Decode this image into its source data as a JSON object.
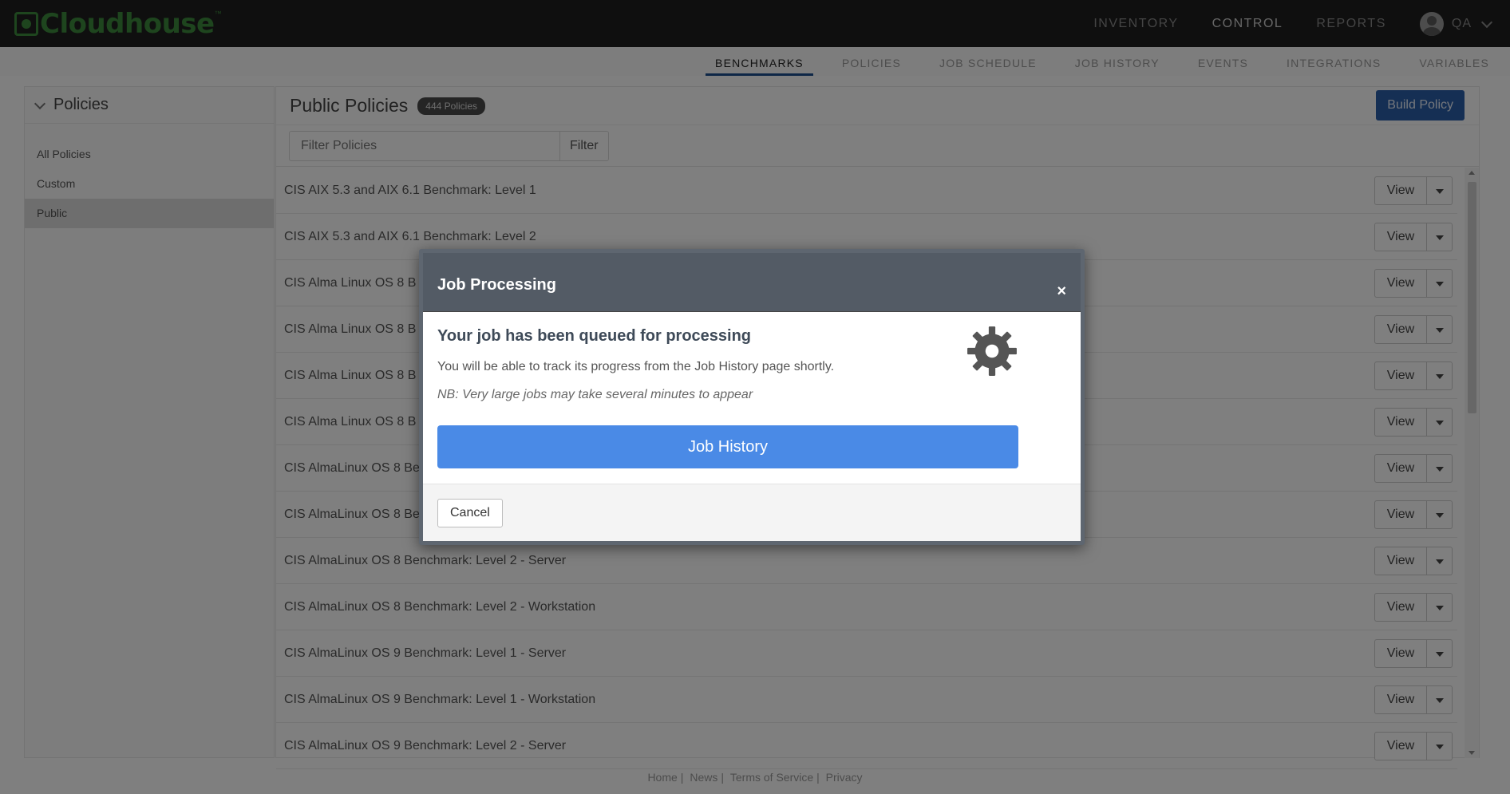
{
  "app": {
    "logo_text": "Cloudhouse",
    "logo_tm": "™",
    "colors": {
      "brand": "#3d8a3d",
      "primary_button": "#2a5ea8",
      "modal_button": "#4a8ae6",
      "modal_header": "#535b65"
    }
  },
  "topnav": {
    "items": [
      "INVENTORY",
      "CONTROL",
      "REPORTS"
    ],
    "active": "CONTROL",
    "user_name": "QA"
  },
  "subnav": {
    "items": [
      "BENCHMARKS",
      "POLICIES",
      "JOB SCHEDULE",
      "JOB HISTORY",
      "EVENTS",
      "INTEGRATIONS",
      "VARIABLES"
    ],
    "active": "BENCHMARKS"
  },
  "sidebar": {
    "title": "Policies",
    "items": [
      "All Policies",
      "Custom",
      "Public"
    ],
    "active": "Public"
  },
  "main": {
    "title": "Public Policies",
    "badge": "444 Policies",
    "build_button": "Build Policy",
    "filter_placeholder": "Filter Policies",
    "filter_button": "Filter",
    "view_label": "View",
    "rows": [
      "CIS AIX 5.3 and AIX 6.1 Benchmark: Level 1",
      "CIS AIX 5.3 and AIX 6.1 Benchmark: Level 2",
      "CIS Alma Linux OS 8 B",
      "CIS Alma Linux OS 8 B",
      "CIS Alma Linux OS 8 B",
      "CIS Alma Linux OS 8 B",
      "CIS AlmaLinux OS 8 Be",
      "CIS AlmaLinux OS 8 Be",
      "CIS AlmaLinux OS 8 Benchmark: Level 2 - Server",
      "CIS AlmaLinux OS 8 Benchmark: Level 2 - Workstation",
      "CIS AlmaLinux OS 9 Benchmark: Level 1 - Server",
      "CIS AlmaLinux OS 9 Benchmark: Level 1 - Workstation",
      "CIS AlmaLinux OS 9 Benchmark: Level 2 - Server"
    ]
  },
  "footer": {
    "links": [
      "Home",
      "News",
      "Terms of Service",
      "Privacy"
    ],
    "separator": "|"
  },
  "modal": {
    "title": "Job Processing",
    "close": "×",
    "heading": "Your job has been queued for processing",
    "text": "You will be able to track its progress from the Job History page shortly.",
    "note": "NB: Very large jobs may take several minutes to appear",
    "primary_button": "Job History",
    "cancel_button": "Cancel",
    "icon": "gear-icon"
  }
}
